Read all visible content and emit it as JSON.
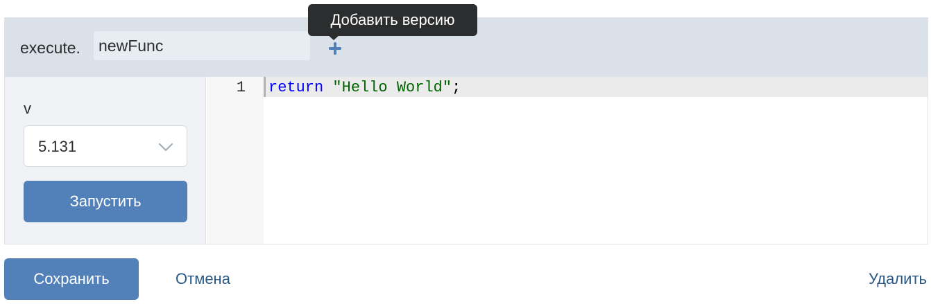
{
  "header": {
    "prefix": "execute.",
    "function_name": "newFunc",
    "add_icon": "plus-icon",
    "tooltip": "Добавить версию"
  },
  "sidebar": {
    "version_label": "v",
    "version_value": "5.131",
    "dropdown_icon": "chevron-down-icon",
    "run_label": "Запустить"
  },
  "editor": {
    "line_number": "1",
    "code": {
      "keyword": "return",
      "space": " ",
      "string": "\"Hello World\"",
      "terminator": ";"
    }
  },
  "footer": {
    "save_label": "Сохранить",
    "cancel_label": "Отмена",
    "delete_label": "Удалить"
  },
  "colors": {
    "accent": "#5181b8",
    "link": "#2a5885",
    "header_bg": "#dae1e9",
    "keyword": "#0000ff",
    "string": "#006400"
  }
}
